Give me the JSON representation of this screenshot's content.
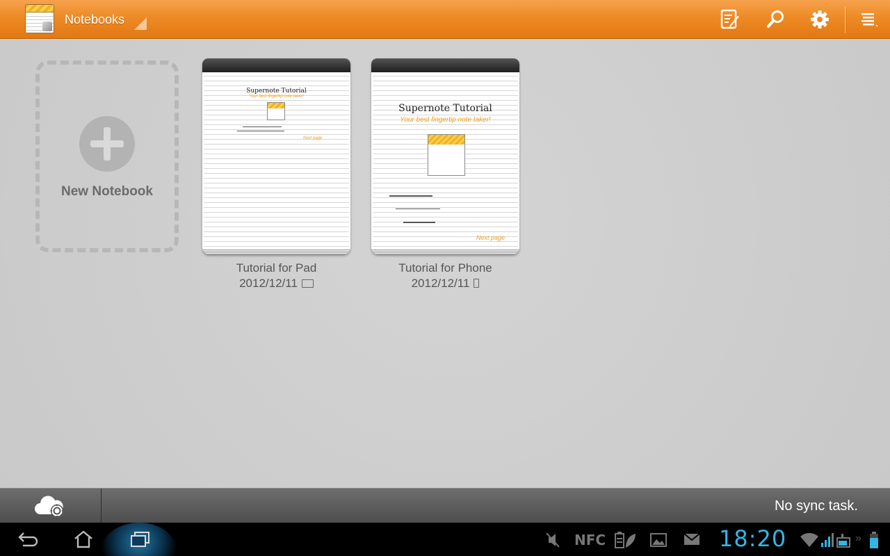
{
  "actionbar": {
    "title": "Notebooks",
    "icons": [
      "app-logo",
      "edit-notebook-icon",
      "search-icon",
      "settings-icon",
      "overflow-menu-icon"
    ]
  },
  "new_notebook": {
    "label": "New Notebook"
  },
  "notebooks": [
    {
      "title": "Tutorial for Pad",
      "date": "2012/12/11",
      "device_icon": "tablet-icon",
      "cover_title": "Supernote Tutorial",
      "cover_subtitle": "Your best fingertip note taker!",
      "cover_next": "Next page"
    },
    {
      "title": "Tutorial for Phone",
      "date": "2012/12/11",
      "device_icon": "phone-icon",
      "cover_title": "Supernote Tutorial",
      "cover_subtitle": "Your best fingertip note taker!",
      "cover_next": "Next page"
    }
  ],
  "syncbar": {
    "status": "No sync task.",
    "icon": "cloud-settings-icon"
  },
  "system": {
    "clock": "18:20",
    "nfc_label": "NFC",
    "accent": "#33b5e5"
  },
  "colors": {
    "actionbar": "#ee8a25",
    "background": "#cfcfcf"
  }
}
